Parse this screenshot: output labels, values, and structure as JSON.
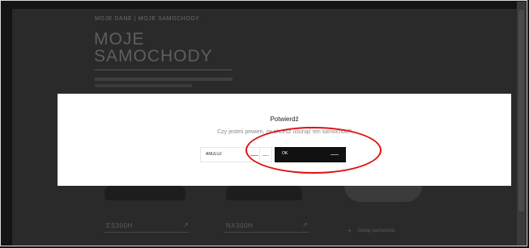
{
  "breadcrumb": "MOJE DANE | MOJE SAMOCHODY",
  "title_line1": "MOJE",
  "title_line2": "SAMOCHODY",
  "cars": [
    {
      "name": "ES300H"
    },
    {
      "name": "NX300H"
    }
  ],
  "add_car_label": "Dodaj samochód",
  "modal": {
    "title": "Potwierdź",
    "message": "Czy jesteś pewien, że chcesz usunąć ten samochód?",
    "no_label": "ANULUJ",
    "yes_label": "OK"
  },
  "colors": {
    "overlay": "#2a2a2a",
    "modal_bg": "#ffffff",
    "primary_button": "#111111",
    "annotation": "#e01010"
  },
  "icons": {
    "arrow": "arrow-right-icon",
    "plus": "plus-icon"
  }
}
